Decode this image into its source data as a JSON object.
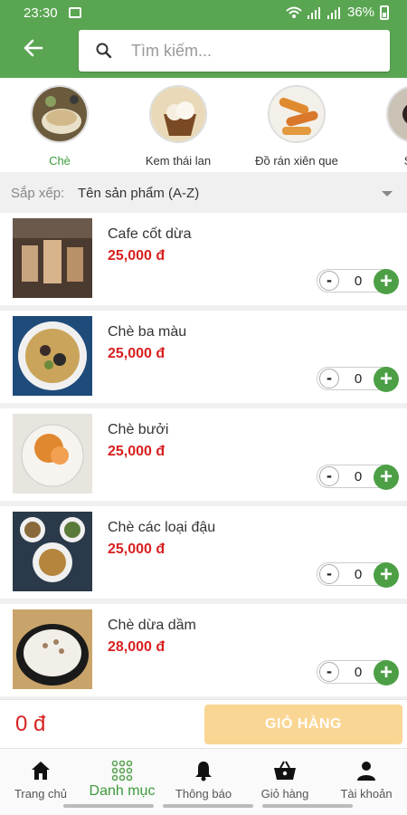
{
  "status": {
    "time": "23:30",
    "battery": "36%"
  },
  "header": {
    "search_placeholder": "Tìm kiếm..."
  },
  "categories": [
    {
      "label": "Chè",
      "active": true
    },
    {
      "label": "Kem thái lan",
      "active": false
    },
    {
      "label": "Đồ rán xiên que",
      "active": false
    },
    {
      "label": "Sữa",
      "active": false
    }
  ],
  "sort": {
    "label": "Sắp xếp:",
    "value": "Tên sản phẩm (A-Z)"
  },
  "products": [
    {
      "name": "Cafe cốt dừa",
      "price": "25,000 đ",
      "qty": "0"
    },
    {
      "name": "Chè ba màu",
      "price": "25,000 đ",
      "qty": "0"
    },
    {
      "name": "Chè bưởi",
      "price": "25,000 đ",
      "qty": "0"
    },
    {
      "name": "Chè các loại đậu",
      "price": "25,000 đ",
      "qty": "0"
    },
    {
      "name": "Chè dừa dầm",
      "price": "28,000 đ",
      "qty": "0"
    }
  ],
  "cart": {
    "total": "0 đ",
    "button_label": "GIỎ HÀNG"
  },
  "nav": [
    {
      "label": "Trang chủ",
      "icon": "home-icon"
    },
    {
      "label": "Danh mục",
      "icon": "grid-icon",
      "active": true
    },
    {
      "label": "Thông báo",
      "icon": "bell-icon"
    },
    {
      "label": "Giỏ hàng",
      "icon": "basket-icon"
    },
    {
      "label": "Tài khoản",
      "icon": "user-icon"
    }
  ],
  "colors": {
    "primary": "#5aa552",
    "price": "#d82020",
    "cart_button": "#f9d694"
  }
}
